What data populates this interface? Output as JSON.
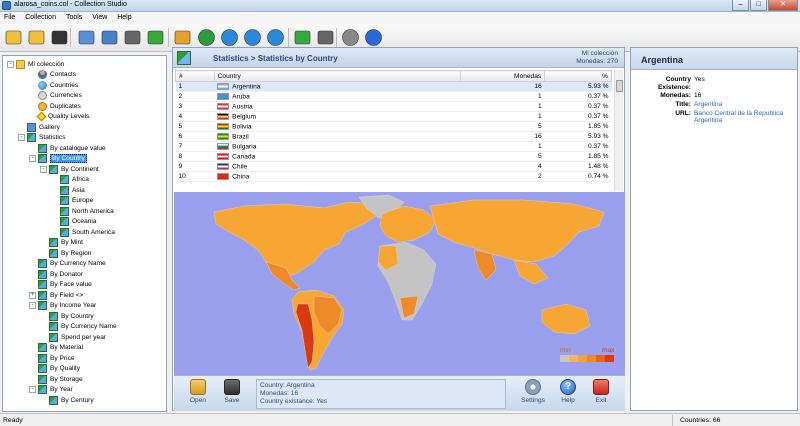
{
  "window": {
    "title": "alarosa_coins.col - Collection Studio",
    "minimize": "–",
    "maximize": "□",
    "close": "✕"
  },
  "menu": [
    "File",
    "Collection",
    "Tools",
    "View",
    "Help"
  ],
  "toolbar": [
    "open-folder",
    "new-folder",
    "save",
    "print-preview",
    "print",
    "search-binoculars",
    "statistics",
    "export",
    "globe-1",
    "globe-2",
    "globe-3",
    "globe-4",
    "download",
    "install",
    "settings",
    "help"
  ],
  "tree": [
    {
      "label": "Mi colección",
      "depth": 0,
      "icon": "folder",
      "exp": "-"
    },
    {
      "label": "Contacts",
      "depth": 2,
      "icon": "person"
    },
    {
      "label": "Countries",
      "depth": 2,
      "icon": "globe"
    },
    {
      "label": "Currencies",
      "depth": 2,
      "icon": "money"
    },
    {
      "label": "Duplicates",
      "depth": 2,
      "icon": "dup"
    },
    {
      "label": "Quality Levels",
      "depth": 2,
      "icon": "key"
    },
    {
      "label": "Gallery",
      "depth": 1,
      "icon": "gallery"
    },
    {
      "label": "Statistics",
      "depth": 1,
      "icon": "stat",
      "exp": "-"
    },
    {
      "label": "By catalogue value",
      "depth": 2,
      "icon": "stat"
    },
    {
      "label": "By Country",
      "depth": 2,
      "icon": "stat",
      "exp": "-",
      "selected": true
    },
    {
      "label": "By Continent",
      "depth": 3,
      "icon": "stat",
      "exp": "-"
    },
    {
      "label": "Africa",
      "depth": 4,
      "icon": "stat"
    },
    {
      "label": "Asia",
      "depth": 4,
      "icon": "stat"
    },
    {
      "label": "Europe",
      "depth": 4,
      "icon": "stat"
    },
    {
      "label": "North America",
      "depth": 4,
      "icon": "stat"
    },
    {
      "label": "Oceania",
      "depth": 4,
      "icon": "stat"
    },
    {
      "label": "South America",
      "depth": 4,
      "icon": "stat"
    },
    {
      "label": "By Mint",
      "depth": 3,
      "icon": "stat"
    },
    {
      "label": "By Region",
      "depth": 3,
      "icon": "stat"
    },
    {
      "label": "By Currency Name",
      "depth": 2,
      "icon": "stat"
    },
    {
      "label": "By Donator",
      "depth": 2,
      "icon": "stat"
    },
    {
      "label": "By Face value",
      "depth": 2,
      "icon": "stat"
    },
    {
      "label": "By Field <>",
      "depth": 2,
      "icon": "stat",
      "exp": "+"
    },
    {
      "label": "By Income Year",
      "depth": 2,
      "icon": "stat",
      "exp": "-"
    },
    {
      "label": "By Country",
      "depth": 3,
      "icon": "stat"
    },
    {
      "label": "By Currency Name",
      "depth": 3,
      "icon": "stat"
    },
    {
      "label": "Spend per year",
      "depth": 3,
      "icon": "stat"
    },
    {
      "label": "By Material",
      "depth": 2,
      "icon": "stat"
    },
    {
      "label": "By Price",
      "depth": 2,
      "icon": "stat"
    },
    {
      "label": "By Quality",
      "depth": 2,
      "icon": "stat"
    },
    {
      "label": "By Storage",
      "depth": 2,
      "icon": "stat"
    },
    {
      "label": "By Year",
      "depth": 2,
      "icon": "stat",
      "exp": "-"
    },
    {
      "label": "By Century",
      "depth": 3,
      "icon": "stat"
    }
  ],
  "center": {
    "breadcrumb": "Statistics  >  Statistics by Country",
    "collection_name": "Mi colección",
    "collection_count": "Monedas: 270",
    "table": {
      "headers": [
        "#",
        "Country",
        "Monedas",
        "%"
      ],
      "rows": [
        {
          "n": "1",
          "country": "Argentina",
          "monedas": "16",
          "pct": "5.93 %",
          "flag": [
            "#74acdf",
            "#ffffff",
            "#74acdf"
          ]
        },
        {
          "n": "2",
          "country": "Aruba",
          "monedas": "1",
          "pct": "0.37 %",
          "flag": [
            "#418fde",
            "#418fde",
            "#418fde"
          ]
        },
        {
          "n": "3",
          "country": "Austria",
          "monedas": "1",
          "pct": "0.37 %",
          "flag": [
            "#ed2939",
            "#ffffff",
            "#ed2939"
          ]
        },
        {
          "n": "4",
          "country": "Belgium",
          "monedas": "1",
          "pct": "0.37 %",
          "flag": [
            "#000000",
            "#fae042",
            "#ed2939"
          ]
        },
        {
          "n": "5",
          "country": "Bolivia",
          "monedas": "5",
          "pct": "1.85 %",
          "flag": [
            "#d52b1e",
            "#f9e300",
            "#007934"
          ]
        },
        {
          "n": "6",
          "country": "Brazil",
          "monedas": "16",
          "pct": "5.93 %",
          "flag": [
            "#009c3b",
            "#ffdf00",
            "#009c3b"
          ]
        },
        {
          "n": "7",
          "country": "Bulgaria",
          "monedas": "1",
          "pct": "0.37 %",
          "flag": [
            "#ffffff",
            "#00966e",
            "#d62612"
          ]
        },
        {
          "n": "8",
          "country": "Canada",
          "monedas": "5",
          "pct": "1.85 %",
          "flag": [
            "#ff0000",
            "#ffffff",
            "#ff0000"
          ]
        },
        {
          "n": "9",
          "country": "Chile",
          "monedas": "4",
          "pct": "1.48 %",
          "flag": [
            "#0039a6",
            "#ffffff",
            "#d52b1e"
          ]
        },
        {
          "n": "10",
          "country": "China",
          "monedas": "2",
          "pct": "0.74 %",
          "flag": [
            "#de2910",
            "#de2910",
            "#de2910"
          ]
        }
      ]
    },
    "legend": {
      "min": "min",
      "max": "max",
      "colors": [
        "#c8c8c8",
        "#f5b06a",
        "#f3a040",
        "#ef8a2a",
        "#e8641a",
        "#d83a12"
      ]
    },
    "map_colors": {
      "ocean": "#9aa0ee",
      "none": "#c4c4c4",
      "low": "#f7a533",
      "mid": "#ef8a2a",
      "high": "#d83a12"
    },
    "bottom": {
      "open": "Open",
      "save": "Save",
      "info_country": "Country: Argentina",
      "info_monedas": "Monedas: 16",
      "info_existance": "Country existance: Yes",
      "settings": "Settings",
      "help": "Help",
      "exit": "Exit"
    }
  },
  "details": {
    "title": "Argentina",
    "rows": [
      {
        "k": "Country",
        "v": "Yes",
        "link": false
      },
      {
        "k": "Existence:",
        "v": "",
        "link": false
      },
      {
        "k": "Monedas:",
        "v": "16",
        "link": false
      },
      {
        "k": "Title:",
        "v": "Argentina",
        "link": true
      },
      {
        "k": "URL:",
        "v": "Banco Central de la Republica Argentina",
        "link": true
      }
    ]
  },
  "status": {
    "left": "Ready",
    "right": "Countries: 66"
  }
}
